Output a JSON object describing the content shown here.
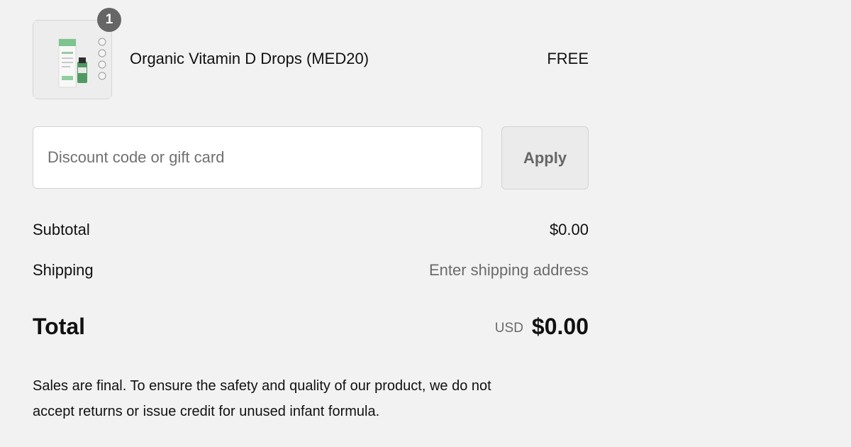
{
  "cart": {
    "item": {
      "quantity": "1",
      "name": "Organic Vitamin D Drops (MED20)",
      "price": "FREE",
      "image_icon": "product-box-bottle"
    }
  },
  "discount": {
    "placeholder": "Discount code or gift card",
    "value": "",
    "apply_label": "Apply"
  },
  "costs": {
    "subtotal_label": "Subtotal",
    "subtotal_value": "$0.00",
    "shipping_label": "Shipping",
    "shipping_value": "Enter shipping address",
    "total_label": "Total",
    "currency": "USD",
    "total_value": "$0.00"
  },
  "policy": {
    "line1": "Sales are final. To ensure the safety and quality of our product, we do not",
    "line2": "accept returns or issue credit for unused infant formula."
  },
  "colors": {
    "background": "#f2f2f2",
    "badge": "#666666",
    "muted_text": "#6b6b6b",
    "product_green": "#4f9a63"
  }
}
